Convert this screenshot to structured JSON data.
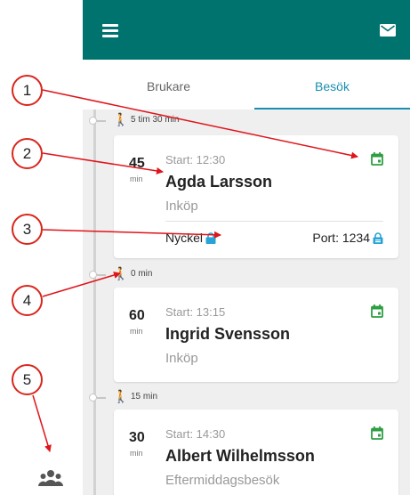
{
  "header": {
    "menu_icon": "hamburger-menu-icon",
    "mail_icon": "mail-icon",
    "bar_color": "#00736f"
  },
  "tabs": [
    {
      "label": "Brukare",
      "active": false
    },
    {
      "label": "Besök",
      "active": true
    }
  ],
  "accent_color": "#1a8fb0",
  "visits": [
    {
      "travel": "5 tim 30 min",
      "minutes": "45",
      "unit": "min",
      "start": "Start: 12:30",
      "name": "Agda Larsson",
      "description": "Inköp",
      "key_label": "Nyckel",
      "port_label": "Port: 1234"
    },
    {
      "travel": "0 min",
      "minutes": "60",
      "unit": "min",
      "start": "Start: 13:15",
      "name": "Ingrid Svensson",
      "description": "Inköp"
    },
    {
      "travel": "15 min",
      "minutes": "30",
      "unit": "min",
      "start": "Start: 14:30",
      "name": "Albert Wilhelmsson",
      "description": "Eftermiddagsbesök"
    }
  ],
  "callouts": [
    "1",
    "2",
    "3",
    "4",
    "5"
  ],
  "callout_color": "#d9261c",
  "icons": {
    "calendar": "calendar-icon",
    "walk": "walking-person-icon",
    "lock": "lock-icon",
    "group": "group-icon"
  }
}
